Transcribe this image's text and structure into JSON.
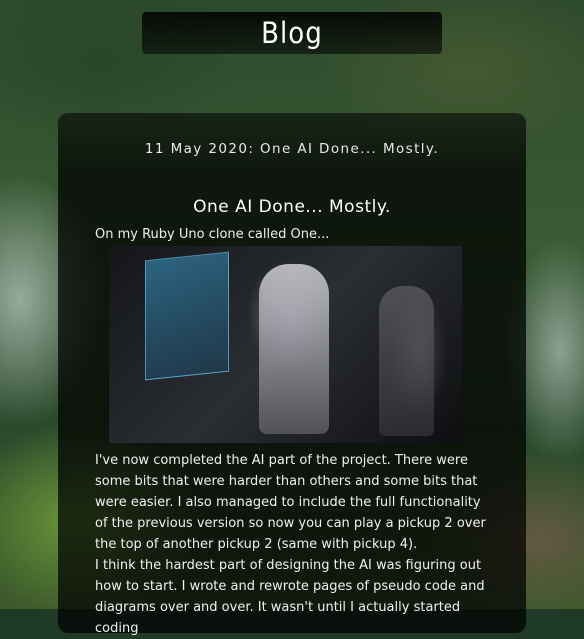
{
  "site": {
    "title": "Blog"
  },
  "post": {
    "header": "11 May 2020: One AI Done... Mostly.",
    "title": "One AI Done... Mostly.",
    "intro": "On my Ruby Uno clone called One...",
    "paragraphs": [
      "I've now completed the AI part of the project. There were some bits that were harder than others and some bits that were easier. I also managed to include the full functionality of the previous version so now you can play a pickup 2 over the top of another pickup 2 (same with pickup 4).",
      "I think the hardest part of designing the AI was figuring out how to start. I wrote and rewrote pages of pseudo code and diagrams over and over. It wasn't until I actually started coding"
    ]
  }
}
